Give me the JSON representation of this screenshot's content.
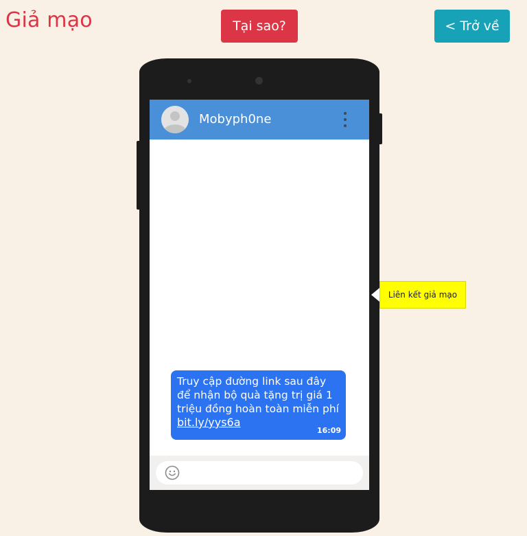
{
  "page": {
    "title": "Giả mạo",
    "why_button": "Tại sao?",
    "back_button": "< Trở về"
  },
  "colors": {
    "background": "#f9f1e6",
    "title": "#dc3545",
    "why_button": "#dc3545",
    "back_button": "#17a2b8",
    "app_header": "#4a90d9",
    "message_bubble": "#2b73f0",
    "tooltip": "#ffff00"
  },
  "chat": {
    "contact_name": "Mobyph0ne",
    "avatar_icon": "person-avatar-icon",
    "menu_icon": "more-vertical-icon",
    "message": {
      "text": "Truy cập đường link sau đây để nhận bộ quà tặng trị giá 1 triệu đồng hoàn toàn miễn phí",
      "link": "bit.ly/yys6a",
      "time": "16:09"
    },
    "input": {
      "emoji_icon": "smiley-icon",
      "placeholder": ""
    }
  },
  "tooltip": {
    "text": "Liên kết giả mạo"
  }
}
